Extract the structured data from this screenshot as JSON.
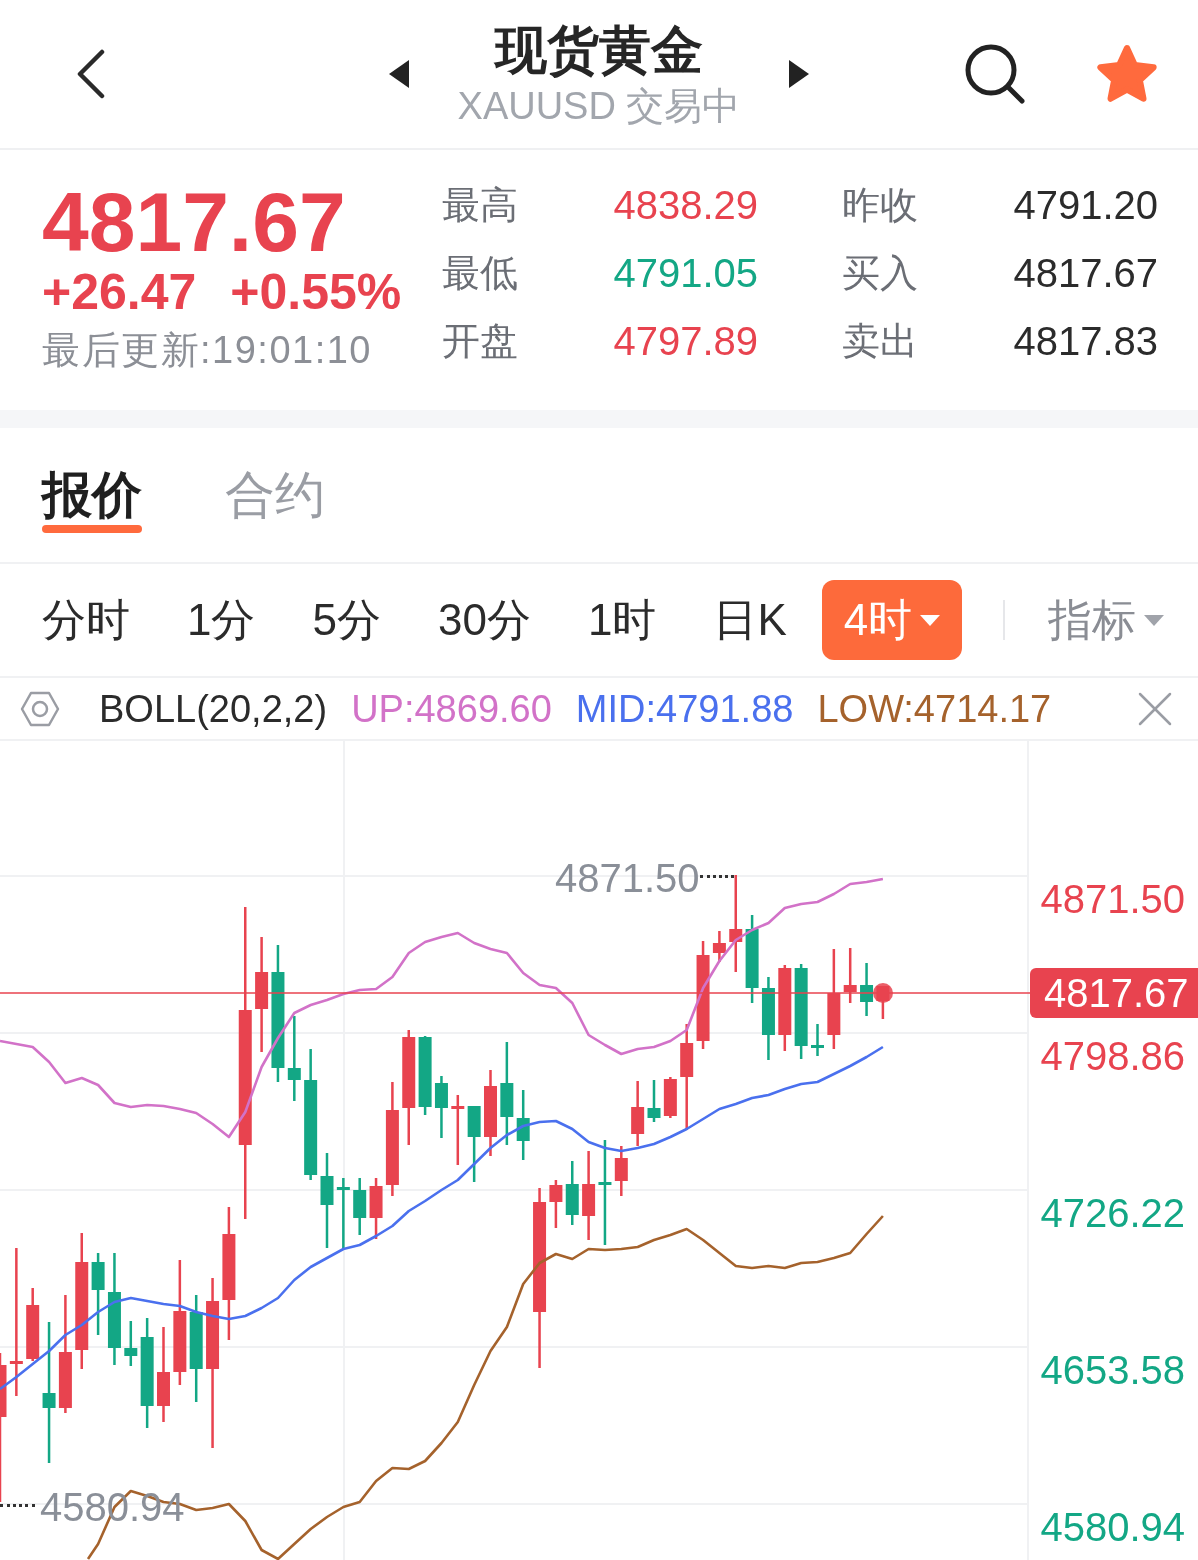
{
  "header": {
    "title": "现货黄金",
    "subtitle": "XAUUSD 交易中",
    "favorite": true
  },
  "quote": {
    "price": "4817.67",
    "change": "+26.47",
    "change_percent": "+0.55%",
    "updated": "最后更新:19:01:10",
    "rising": true
  },
  "stats": [
    {
      "label": "最高",
      "value": "4838.29",
      "color": "#e8434f"
    },
    {
      "label": "昨收",
      "value": "4791.20",
      "color": "#2b2b2b"
    },
    {
      "label": "最低",
      "value": "4791.05",
      "color": "#13a785"
    },
    {
      "label": "买入",
      "value": "4817.67",
      "color": "#2b2b2b"
    },
    {
      "label": "开盘",
      "value": "4797.89",
      "color": "#e8434f"
    },
    {
      "label": "卖出",
      "value": "4817.83",
      "color": "#2b2b2b"
    }
  ],
  "tabs": [
    {
      "label": "报价",
      "selected": true
    },
    {
      "label": "合约",
      "selected": false
    }
  ],
  "periods": [
    {
      "label": "分时",
      "kind": "period",
      "selected": false
    },
    {
      "label": "1分",
      "kind": "period",
      "selected": false
    },
    {
      "label": "5分",
      "kind": "period",
      "selected": false
    },
    {
      "label": "30分",
      "kind": "period",
      "selected": false
    },
    {
      "label": "1时",
      "kind": "period",
      "selected": false
    },
    {
      "label": "日K",
      "kind": "period",
      "selected": false
    },
    {
      "label": "4时",
      "kind": "menu",
      "selected": true
    }
  ],
  "indicator_menu": {
    "label": "指标"
  },
  "indicator": {
    "name": "BOLL(20,2,2)",
    "values": [
      {
        "text": "UP:4869.60",
        "color": "#d272c8"
      },
      {
        "text": "MID:4791.88",
        "color": "#4a70ee"
      },
      {
        "text": "LOW:4714.17",
        "color": "#a5622c"
      }
    ]
  },
  "chart": {
    "high_marker": "4871.50",
    "low_marker": "4580.94",
    "last_price": "4817.67",
    "axis_labels": [
      {
        "text": "4871.50",
        "color": "#e8434f"
      },
      {
        "text": "4798.86",
        "color": "#e8434f"
      },
      {
        "text": "4726.22",
        "color": "#13a785"
      },
      {
        "text": "4653.58",
        "color": "#13a785"
      },
      {
        "text": "4580.94",
        "color": "#13a785"
      }
    ]
  }
}
